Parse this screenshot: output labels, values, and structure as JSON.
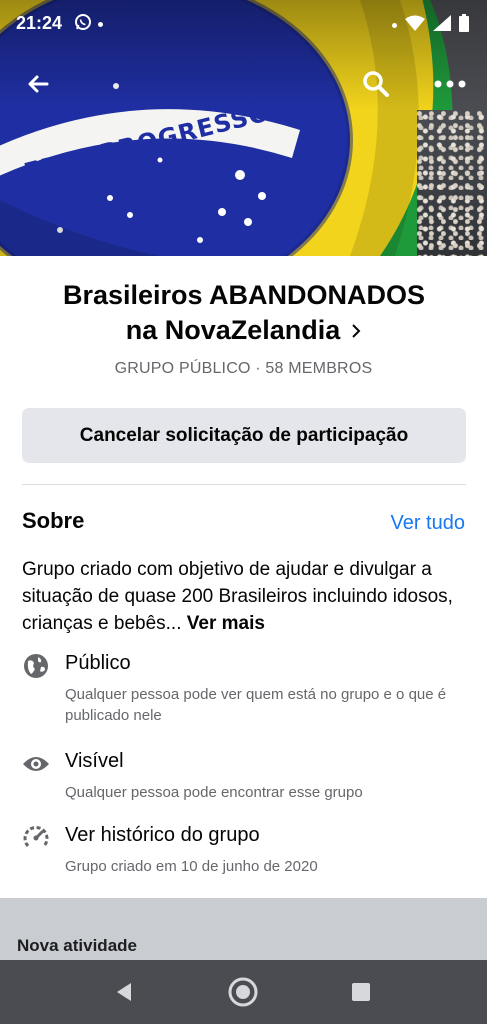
{
  "status_bar": {
    "time": "21:24",
    "left_icons": [
      "whatsapp-icon",
      "notification-dot-icon"
    ],
    "right_icons": [
      "notification-dot-icon",
      "wifi-icon",
      "signal-icon",
      "battery-icon"
    ]
  },
  "cover": {
    "banner_text": "EM E PROGRESSO"
  },
  "top_nav": {
    "icons": [
      "back-arrow-icon",
      "search-icon",
      "more-options-icon"
    ]
  },
  "group": {
    "title_line1": "Brasileiros ABANDONADOS",
    "title_line2": "na NovaZelandia",
    "meta": "GRUPO PÚBLICO · 58 MEMBROS",
    "cancel_button": "Cancelar solicitação de participação"
  },
  "about": {
    "title": "Sobre",
    "see_all": "Ver tudo",
    "description": "Grupo criado com objetivo de ajudar e divulgar a situação de quase 200 Brasileiros incluindo idosos, crianças e bebês...",
    "see_more": "Ver mais",
    "items": [
      {
        "icon": "globe-icon",
        "title": "Público",
        "subtitle": "Qualquer pessoa pode ver quem está no grupo e o que é publicado nele"
      },
      {
        "icon": "eye-icon",
        "title": "Visível",
        "subtitle": "Qualquer pessoa pode encontrar esse grupo"
      },
      {
        "icon": "history-icon",
        "title": "Ver histórico do grupo",
        "subtitle": "Grupo criado em 10 de junho de 2020"
      }
    ]
  },
  "activity": {
    "label": "Nova atividade"
  },
  "android_nav": {
    "icons": [
      "back-triangle-icon",
      "home-circle-icon",
      "recents-square-icon"
    ]
  },
  "colors": {
    "link_blue": "#1877f2",
    "button_gray": "#e4e6eb",
    "secondary_text": "#65676b",
    "flag_green": "#1f9a3b",
    "flag_yellow": "#f2d41c",
    "flag_blue": "#1f2fa3"
  }
}
